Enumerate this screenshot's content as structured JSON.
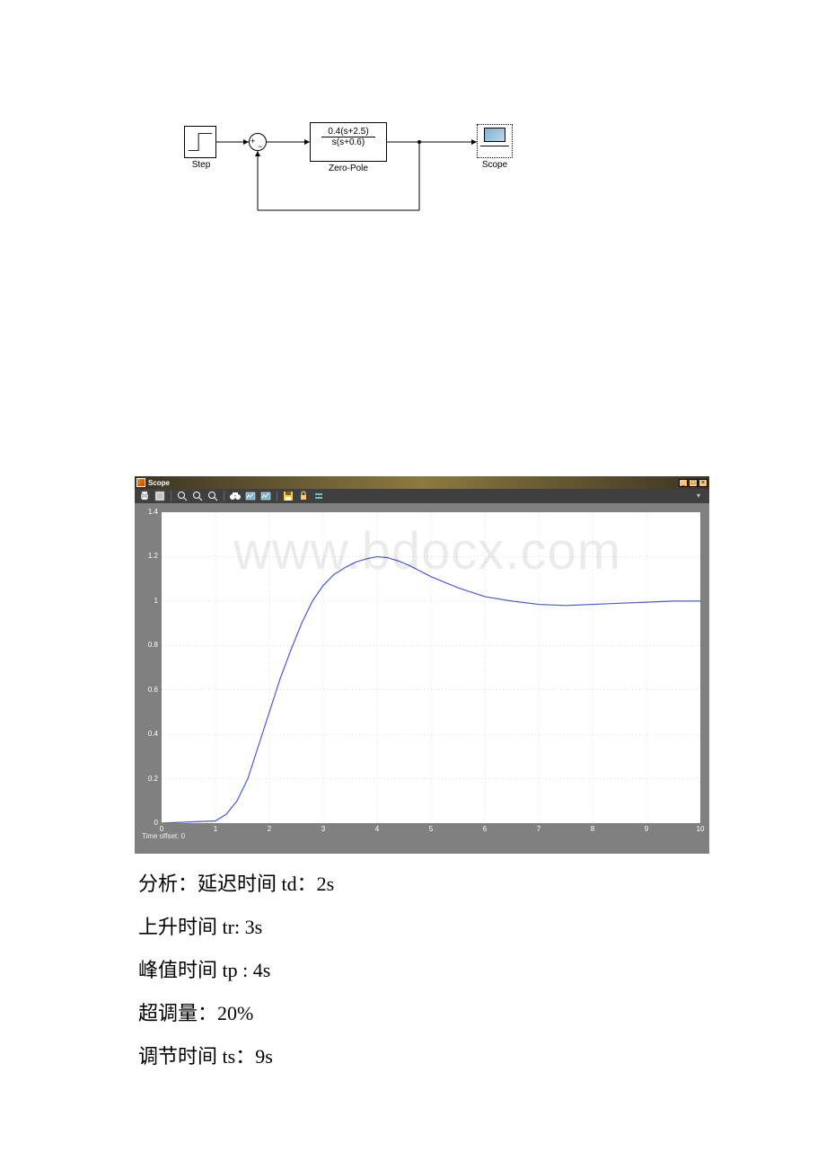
{
  "diagram": {
    "step_label": "Step",
    "zero_pole_label": "Zero-Pole",
    "zero_pole_numerator": "0.4(s+2.5)",
    "zero_pole_denominator": "s(s+0.6)",
    "scope_label": "Scope",
    "sum_plus": "+",
    "sum_minus": "−"
  },
  "scope_window": {
    "title": "Scope",
    "win_buttons": {
      "min": "_",
      "max": "□",
      "close": "×"
    },
    "time_offset": "Time offset: 0",
    "toolbar_icons": [
      "print",
      "doc",
      "zoom",
      "zoom",
      "zoom",
      "binoc",
      "chart",
      "chart",
      "floppy",
      "lock",
      "info"
    ]
  },
  "chart_data": {
    "type": "line",
    "title": "",
    "xlabel": "",
    "ylabel": "",
    "xlim": [
      0,
      10
    ],
    "ylim": [
      0,
      1.4
    ],
    "xticks": [
      0,
      1,
      2,
      3,
      4,
      5,
      6,
      7,
      8,
      9,
      10
    ],
    "yticks": [
      0,
      0.2,
      0.4,
      0.6,
      0.8,
      1,
      1.2,
      1.4
    ],
    "x": [
      0,
      1,
      1.2,
      1.4,
      1.6,
      1.8,
      2,
      2.2,
      2.4,
      2.6,
      2.8,
      3,
      3.2,
      3.4,
      3.6,
      3.8,
      4,
      4.2,
      4.4,
      4.6,
      4.8,
      5,
      5.5,
      6,
      6.5,
      7,
      7.5,
      8,
      8.5,
      9,
      9.5,
      10
    ],
    "y": [
      0,
      0.01,
      0.04,
      0.1,
      0.2,
      0.35,
      0.5,
      0.65,
      0.78,
      0.9,
      1,
      1.07,
      1.12,
      1.15,
      1.175,
      1.19,
      1.2,
      1.195,
      1.18,
      1.16,
      1.135,
      1.11,
      1.06,
      1.02,
      1,
      0.985,
      0.98,
      0.985,
      0.99,
      0.995,
      1,
      1
    ]
  },
  "analysis": {
    "line1_prefix": "分析：延迟时间 ",
    "line1_sym": "td：",
    "line1_val": "2s",
    "line2_prefix": "上升时间 ",
    "line2_sym": "tr: ",
    "line2_val": "3s",
    "line3_prefix": "峰值时间 ",
    "line3_sym": "tp : ",
    "line3_val": "4s",
    "line4_prefix": "超调量：",
    "line4_val": "20%",
    "line5_prefix": "调节时间 ",
    "line5_sym": "ts：",
    "line5_val": "9s"
  },
  "watermark": "www.bdocx.com"
}
